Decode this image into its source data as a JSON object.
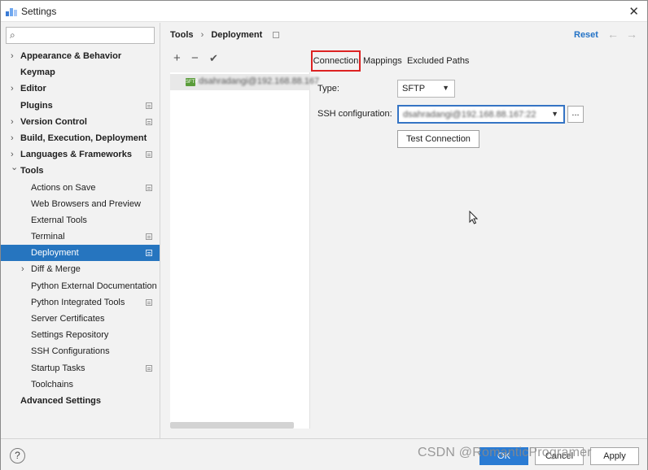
{
  "window": {
    "title": "Settings",
    "close_glyph": "✕"
  },
  "search": {
    "value": "",
    "placeholder": "",
    "icon": "search-icon"
  },
  "sidebar": {
    "items": [
      {
        "label": "Appearance & Behavior",
        "arrow": "›",
        "bold": true,
        "badge": false,
        "indent": 0
      },
      {
        "label": "Keymap",
        "arrow": "",
        "bold": true,
        "badge": false,
        "indent": 0
      },
      {
        "label": "Editor",
        "arrow": "›",
        "bold": true,
        "badge": false,
        "indent": 0
      },
      {
        "label": "Plugins",
        "arrow": "",
        "bold": true,
        "badge": true,
        "indent": 0
      },
      {
        "label": "Version Control",
        "arrow": "›",
        "bold": true,
        "badge": true,
        "indent": 0
      },
      {
        "label": "Build, Execution, Deployment",
        "arrow": "›",
        "bold": true,
        "badge": false,
        "indent": 0
      },
      {
        "label": "Languages & Frameworks",
        "arrow": "›",
        "bold": true,
        "badge": true,
        "indent": 0
      },
      {
        "label": "Tools",
        "arrow": "⌄",
        "bold": true,
        "badge": false,
        "indent": 0
      },
      {
        "label": "Actions on Save",
        "arrow": "",
        "bold": false,
        "badge": true,
        "indent": 1
      },
      {
        "label": "Web Browsers and Preview",
        "arrow": "",
        "bold": false,
        "badge": false,
        "indent": 1
      },
      {
        "label": "External Tools",
        "arrow": "",
        "bold": false,
        "badge": false,
        "indent": 1
      },
      {
        "label": "Terminal",
        "arrow": "",
        "bold": false,
        "badge": true,
        "indent": 1
      },
      {
        "label": "Deployment",
        "arrow": "",
        "bold": false,
        "badge": true,
        "indent": 1,
        "selected": true
      },
      {
        "label": "Diff & Merge",
        "arrow": "›",
        "bold": false,
        "badge": false,
        "indent": 1
      },
      {
        "label": "Python External Documentation",
        "arrow": "",
        "bold": false,
        "badge": false,
        "indent": 1
      },
      {
        "label": "Python Integrated Tools",
        "arrow": "",
        "bold": false,
        "badge": true,
        "indent": 1
      },
      {
        "label": "Server Certificates",
        "arrow": "",
        "bold": false,
        "badge": false,
        "indent": 1
      },
      {
        "label": "Settings Repository",
        "arrow": "",
        "bold": false,
        "badge": false,
        "indent": 1
      },
      {
        "label": "SSH Configurations",
        "arrow": "",
        "bold": false,
        "badge": false,
        "indent": 1
      },
      {
        "label": "Startup Tasks",
        "arrow": "",
        "bold": false,
        "badge": true,
        "indent": 1
      },
      {
        "label": "Toolchains",
        "arrow": "",
        "bold": false,
        "badge": false,
        "indent": 1
      },
      {
        "label": "Advanced Settings",
        "arrow": "",
        "bold": true,
        "badge": false,
        "indent": 0
      }
    ]
  },
  "header": {
    "crumb_parent": "Tools",
    "crumb_sep": "›",
    "crumb_current": "Deployment",
    "reset_label": "Reset",
    "back_glyph": "←",
    "forward_glyph": "→"
  },
  "toolbar": {
    "add_glyph": "+",
    "remove_glyph": "−",
    "apply_glyph": "✔"
  },
  "servers": [
    {
      "name": "dsahradangi@192.168.88.167",
      "icon_text": "SFTP"
    }
  ],
  "tabs": {
    "connection": "Connection",
    "mappings": "Mappings",
    "excluded": "Excluded Paths"
  },
  "form": {
    "type_label": "Type:",
    "type_value": "SFTP",
    "ssh_label": "SSH configuration:",
    "ssh_value": "dsahradangi@192.168.88.167:22",
    "browse_label": "...",
    "test_button": "Test Connection"
  },
  "footer": {
    "help_glyph": "?",
    "ok_label": "OK",
    "cancel_label": "Cancel",
    "apply_label": "Apply",
    "watermark": "CSDN @RomanticProgramer"
  },
  "colors": {
    "accent": "#2675bf",
    "highlight_box": "#dd2222",
    "link": "#2473c6"
  }
}
